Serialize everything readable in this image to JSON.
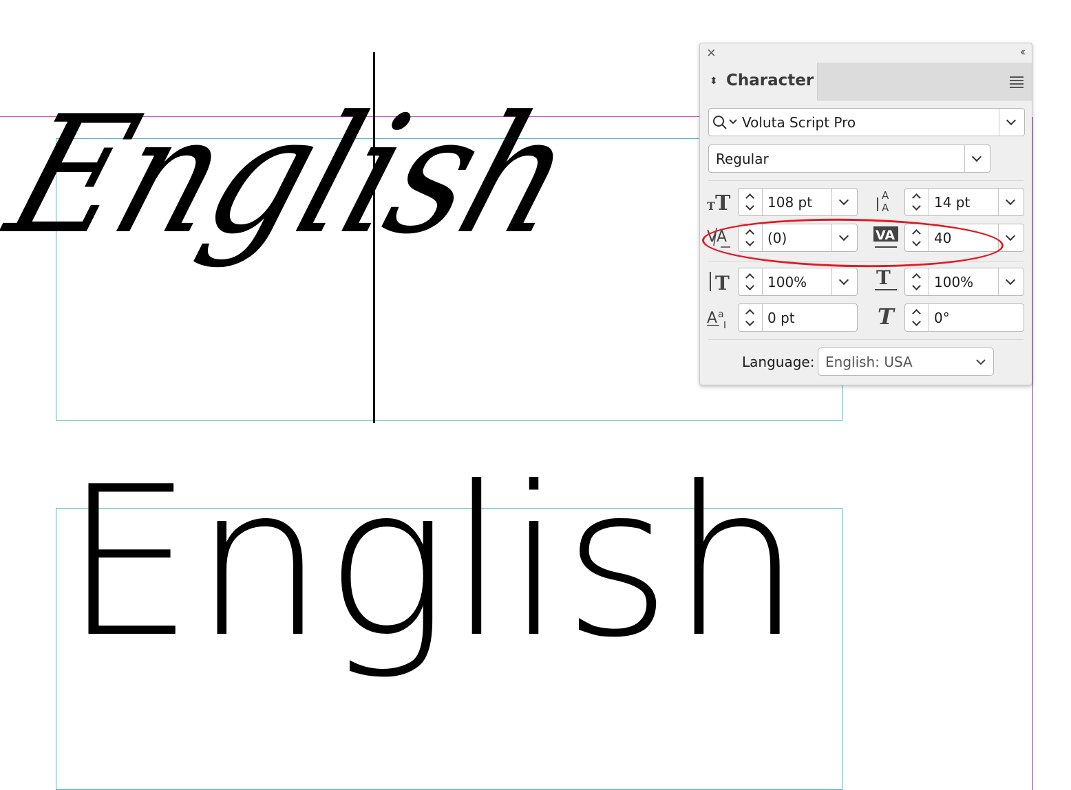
{
  "canvas": {
    "sample_text_script": "English",
    "sample_text_print": "English"
  },
  "panel": {
    "title": "Character",
    "font_family": "Voluta Script Pro",
    "font_style": "Regular",
    "font_size": "108 pt",
    "leading": "14 pt",
    "kerning": "(0)",
    "tracking": "40",
    "vertical_scale": "100%",
    "horizontal_scale": "100%",
    "baseline_shift": "0 pt",
    "skew": "0°",
    "language_label": "Language:",
    "language_value": "English: USA"
  },
  "colors": {
    "highlight": "#e01b24",
    "frame": "#3bb9c8",
    "guide": "#e040c8"
  }
}
